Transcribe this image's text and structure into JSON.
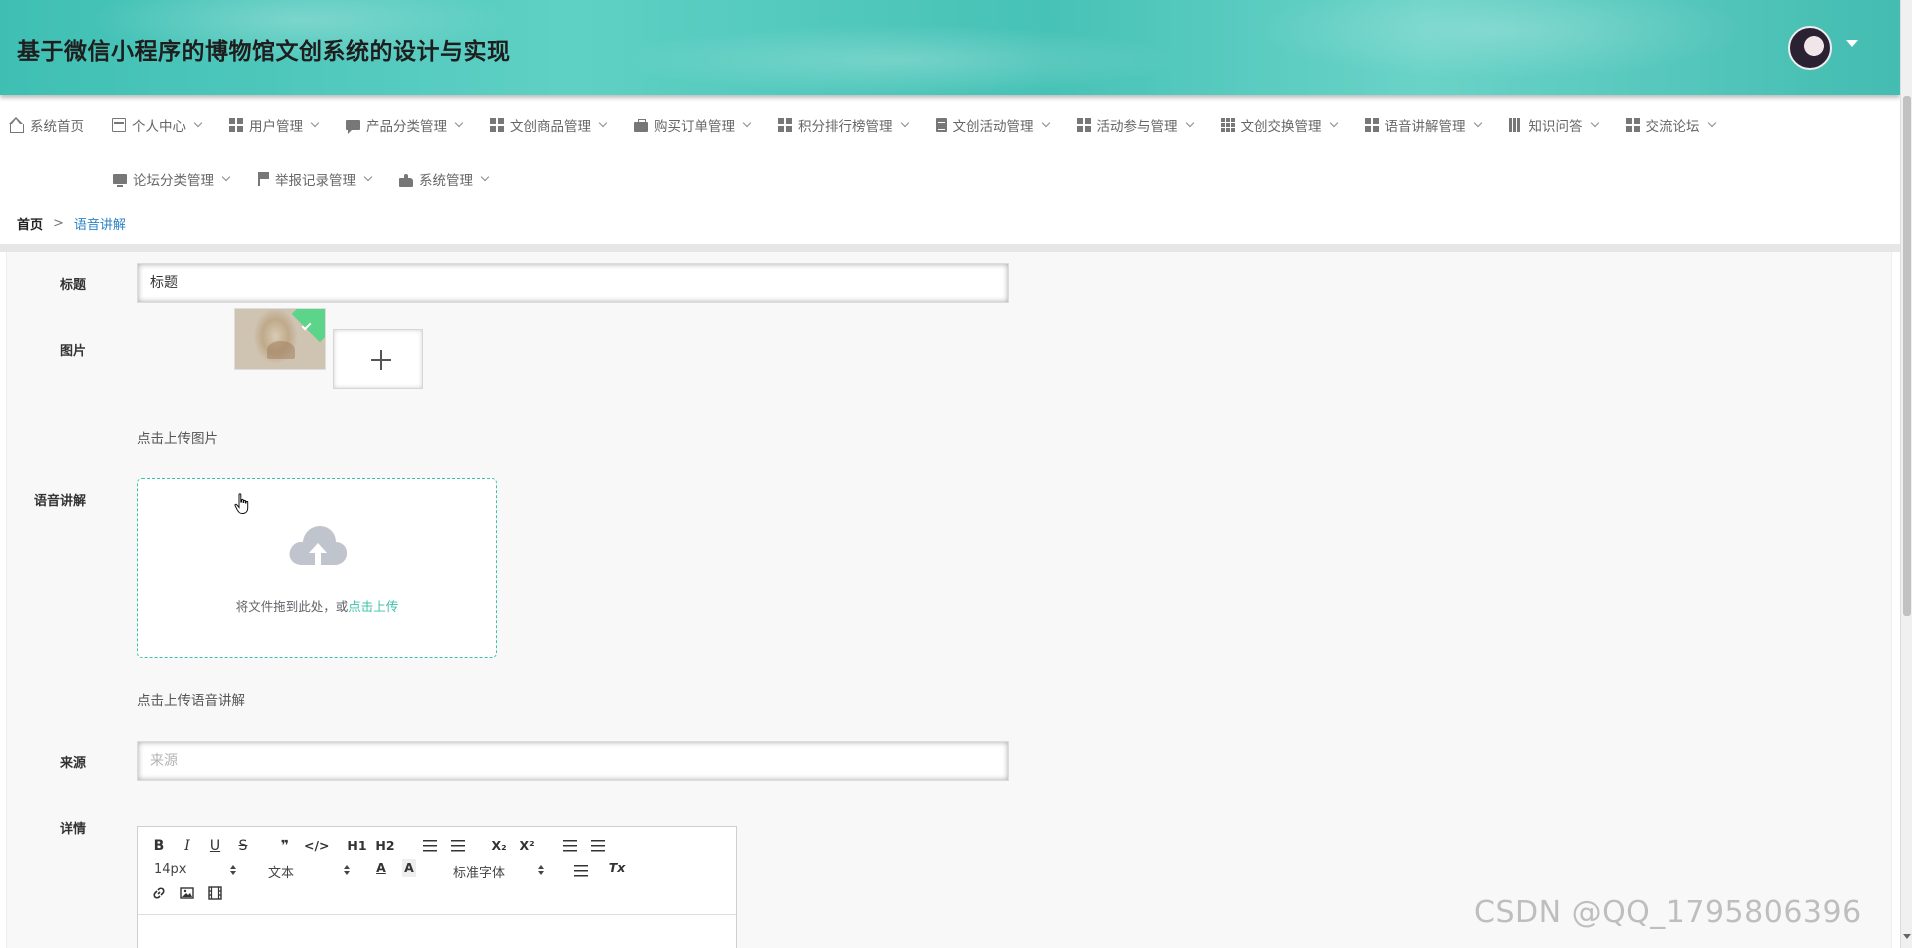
{
  "header": {
    "title": "基于微信小程序的博物馆文创系统的设计与实现"
  },
  "nav": {
    "row1": [
      {
        "label": "系统首页",
        "icon": "home-icon",
        "has_caret": false
      },
      {
        "label": "个人中心",
        "icon": "id-card-icon",
        "has_caret": true
      },
      {
        "label": "用户管理",
        "icon": "grid-icon",
        "has_caret": true
      },
      {
        "label": "产品分类管理",
        "icon": "chat-icon",
        "has_caret": true
      },
      {
        "label": "文创商品管理",
        "icon": "grid-icon",
        "has_caret": true
      },
      {
        "label": "购买订单管理",
        "icon": "briefcase-icon",
        "has_caret": true
      },
      {
        "label": "积分排行榜管理",
        "icon": "grid-icon",
        "has_caret": true
      },
      {
        "label": "文创活动管理",
        "icon": "clipboard-icon",
        "has_caret": true
      },
      {
        "label": "活动参与管理",
        "icon": "grid-icon",
        "has_caret": true
      },
      {
        "label": "文创交换管理",
        "icon": "table-icon",
        "has_caret": true
      },
      {
        "label": "语音讲解管理",
        "icon": "grid-icon",
        "has_caret": true
      },
      {
        "label": "知识问答",
        "icon": "bar-chart-icon",
        "has_caret": true
      },
      {
        "label": "交流论坛",
        "icon": "grid-icon",
        "has_caret": true
      }
    ],
    "row2": [
      {
        "label": "论坛分类管理",
        "icon": "monitor-icon",
        "has_caret": true
      },
      {
        "label": "举报记录管理",
        "icon": "flag-icon",
        "has_caret": true
      },
      {
        "label": "系统管理",
        "icon": "thumbs-up-icon",
        "has_caret": true
      }
    ]
  },
  "breadcrumb": {
    "home": "首页",
    "separator": ">",
    "current": "语音讲解"
  },
  "form": {
    "title_label": "标题",
    "title_value": "标题",
    "image_label": "图片",
    "image_hint": "点击上传图片",
    "audio_label": "语音讲解",
    "upload_text": "将文件拖到此处，或",
    "upload_link": "点击上传",
    "audio_hint": "点击上传语音讲解",
    "source_label": "来源",
    "source_placeholder": "来源",
    "detail_label": "详情"
  },
  "editor": {
    "font_size": "14px",
    "paragraph": "文本",
    "font_family": "标准字体",
    "buttons": {
      "bold": "B",
      "italic": "I",
      "underline": "U",
      "strike": "S",
      "quote": "❞",
      "code": "</>",
      "h1": "H1",
      "h2": "H2",
      "subscript": "X₂",
      "superscript": "X²",
      "color": "A",
      "background": "A",
      "clean": "Tx"
    }
  },
  "watermark": "CSDN @QQ_1795806396",
  "colors": {
    "accent": "#3cc2a8",
    "breadcrumb_current": "#2c83c5",
    "header_teal": "#47c2b6"
  }
}
